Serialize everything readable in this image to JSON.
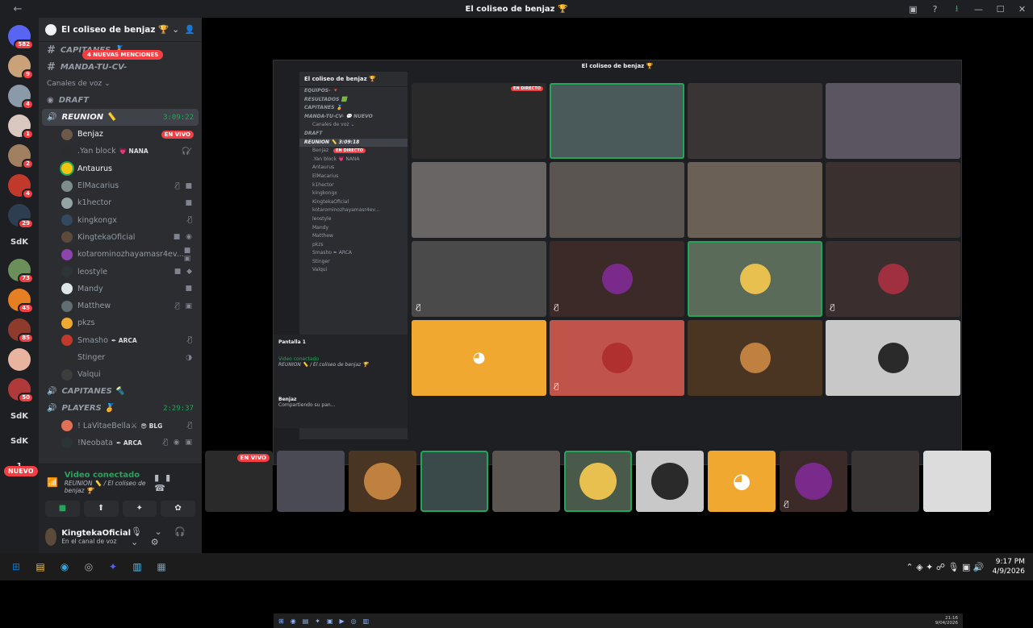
{
  "window": {
    "title": "El coliseo de benjaz 🏆",
    "back": "←",
    "forward": "→",
    "controls": [
      "▣",
      "?",
      "⭳",
      "—",
      "☐",
      "✕"
    ]
  },
  "guilds": {
    "items": [
      {
        "badge": "582",
        "color": "#5865f2"
      },
      {
        "badge": "9",
        "color": "#c9a27a"
      },
      {
        "badge": "4",
        "color": "#8a9aa8"
      },
      {
        "badge": "1",
        "color": "#d9c8c0"
      },
      {
        "badge": "2",
        "color": "#a08060"
      },
      {
        "badge": "4",
        "color": "#c0392b"
      },
      {
        "badge": "29",
        "color": "#2c3e50"
      }
    ],
    "text1": "SdK",
    "items2": [
      {
        "badge": "73",
        "color": "#6a8f5a"
      },
      {
        "badge": "45",
        "color": "#e67e22"
      },
      {
        "badge": "85",
        "color": "#8e3b2e"
      },
      {
        "badge": "",
        "color": "#e8b4a0"
      },
      {
        "badge": "50",
        "color": "#b03a3a"
      }
    ],
    "text2": "SdK",
    "text3": "SdK",
    "text4": "1",
    "nuevo": "NUEVO"
  },
  "sidebar": {
    "server_name": "El coliseo de benjaz 🏆",
    "mentions_pill": "4 NUEVAS MENCIONES",
    "channels_top": [
      {
        "name": "CAPITANES 🏅"
      },
      {
        "name": "MANDA-TU-CV-"
      }
    ],
    "voice_category": "Canales de voz ⌄",
    "draft": "DRAFT",
    "reunion": {
      "name": "REUNION 📏",
      "time": "3:09:22"
    },
    "members": [
      {
        "name": "Benjaz",
        "live": "EN VIVO",
        "color": "#6b5a4a",
        "bright": true
      },
      {
        "name": ".Yan block",
        "tag": "💗 NANA",
        "color": "#2c2c2c",
        "icons": "🎧̸"
      },
      {
        "name": "Antaurus",
        "color": "#f1c40f",
        "bright": true,
        "speaking": true
      },
      {
        "name": "ElMacarius",
        "color": "#7f8c8d",
        "icons": "🎙̸ ■"
      },
      {
        "name": "k1hector",
        "color": "#95a5a6",
        "icons": "■"
      },
      {
        "name": "kingkongx",
        "color": "#34495e",
        "icons": "🎙̸"
      },
      {
        "name": "KingtekaOficial",
        "color": "#5c4a3a",
        "icons": "■ ◉"
      },
      {
        "name": "kotarominozhayamasr4ev...",
        "color": "#8e44ad",
        "icons": "■ ▣"
      },
      {
        "name": "leostyle",
        "color": "#2d3436",
        "icons": "■ ◆"
      },
      {
        "name": "Mandy",
        "color": "#dfe6e9",
        "icons": "■"
      },
      {
        "name": "Matthew",
        "color": "#636e72",
        "icons": "🎙̸ ▣"
      },
      {
        "name": "pkzs",
        "color": "#f0a830"
      },
      {
        "name": "Smasho",
        "tag": "✒ ARCA",
        "color": "#c0392b",
        "icons": "🎙̸"
      },
      {
        "name": "Stinger",
        "color": "#2d2d2d",
        "icons": "◑"
      },
      {
        "name": "Valqui",
        "color": "#3d3d3d"
      }
    ],
    "capitanes": "CAPITANES 🔦",
    "players": {
      "name": "PLAYERS 🏅",
      "time": "2:29:37"
    },
    "players_members": [
      {
        "name": "! LaVitaeBella⚔",
        "tag": "😎 BLG",
        "color": "#e17055",
        "icons": "🎙̸"
      },
      {
        "name": "!Neobata",
        "tag": "✒ ARCA",
        "color": "#2d3436",
        "icons": "🎙̸ ◉ ▣"
      }
    ]
  },
  "voice_panel": {
    "status": "Video conectado",
    "location": "REUNION 📏 / El coliseo de benjaz 🏆",
    "right_icons": "▮▮ ☎",
    "buttons": [
      "■",
      "⬆",
      "✦",
      "✿"
    ]
  },
  "user": {
    "name": "KingtekaOficial",
    "status": "En el canal de voz",
    "controls": "🎙 ⌄ 🎧 ⌄ ⚙"
  },
  "inner": {
    "title": "El coliseo de benjaz 🏆",
    "server": "El coliseo de benjaz 🏆",
    "rows": [
      {
        "t": "EQUIPOS- 🔻",
        "c": true
      },
      {
        "t": "RESULTADOS 🟩",
        "c": true
      },
      {
        "t": "CAPITANES 🏅",
        "c": true
      },
      {
        "t": "MANDA-TU-CV- 💬  NUEVO",
        "c": true
      },
      {
        "t": "Canales de voz ⌄",
        "c": false
      },
      {
        "t": "DRAFT",
        "c": true
      },
      {
        "t": "REUNION 📏   3:09:18",
        "c": true,
        "act": true
      },
      {
        "t": "Benjaz",
        "live": "EN DIRECTO"
      },
      {
        "t": ".Yan block 💗 NANA"
      },
      {
        "t": "Antaurus"
      },
      {
        "t": "ElMacarius"
      },
      {
        "t": "k1hector"
      },
      {
        "t": "kingkongx"
      },
      {
        "t": "KingtekaOficial"
      },
      {
        "t": "kotarominozhayamasr4ev..."
      },
      {
        "t": "leostyle"
      },
      {
        "t": "Mandy"
      },
      {
        "t": "Matthew"
      },
      {
        "t": "pkzs"
      },
      {
        "t": "Smasho ✒ ARCA"
      },
      {
        "t": "Stinger"
      },
      {
        "t": "Valqui"
      }
    ],
    "vp_screen": "Pantalla 1",
    "vp_status": "Video conectado",
    "vp_loc": "REUNION 📏 / El coliseo de benjaz 🏆",
    "vp_user": "Benjaz",
    "vp_user_status": "Compartiendo su pan...",
    "tray": "21:16\n9/04/2026",
    "taskbar_icons": [
      "⊞",
      "◉",
      "▤",
      "✦",
      "▣",
      "▶",
      "◎",
      "▥"
    ],
    "tiles": [
      {
        "color": "#2a2a2a",
        "live": "EN DIRECTO"
      },
      {
        "color": "#4a5a5a",
        "sel": true
      },
      {
        "color": "#3a3535"
      },
      {
        "color": "#5a5560"
      },
      {
        "color": "#6a6565"
      },
      {
        "color": "#5a5550"
      },
      {
        "color": "#6a6055"
      },
      {
        "color": "#3a3030"
      },
      {
        "color": "#4a4a4a",
        "mute": "🎙̸"
      },
      {
        "color": "#3b2a28",
        "av": "#7a2a8a",
        "mute": "🎙̸"
      },
      {
        "color": "#5b6b5a",
        "av": "#e8c050",
        "sel": true
      },
      {
        "color": "#3b2e2e",
        "av": "#a03040",
        "mute": "🎙̸"
      },
      {
        "color": "#f0a830",
        "av": "#f0a830",
        "discord": true
      },
      {
        "color": "#c0544a",
        "av": "#b03030",
        "mute": "🎙̸"
      },
      {
        "color": "#4a3522",
        "av": "#c08040"
      },
      {
        "color": "#c8c8c8",
        "av": "#2a2a2a"
      }
    ]
  },
  "strip": [
    {
      "color": "#2a2a2a",
      "live": "EN VIVO"
    },
    {
      "color": "#4a4a55"
    },
    {
      "color": "#4a3522",
      "av": "#c08040"
    },
    {
      "color": "#3a4a4a",
      "sel": true
    },
    {
      "color": "#5a5550"
    },
    {
      "color": "#4a5a4a",
      "av": "#e8c050",
      "sel": true
    },
    {
      "color": "#c8c8c8",
      "av": "#2a2a2a"
    },
    {
      "color": "#f0a830",
      "discord": true
    },
    {
      "color": "#3b2a28",
      "av": "#7a2a8a",
      "mute": "🎙̸"
    },
    {
      "color": "#3a3535"
    },
    {
      "color": "#dcdcdc"
    }
  ],
  "taskbar": {
    "icons": [
      "⊞",
      "▤",
      "◉",
      "◎",
      "✦",
      "▥",
      "▦"
    ],
    "tray_icons": "⌃ ◈ ✦ ☍ 🎙 ▣ 🔊",
    "time": "9:17 PM",
    "date": "4/9/2026"
  }
}
